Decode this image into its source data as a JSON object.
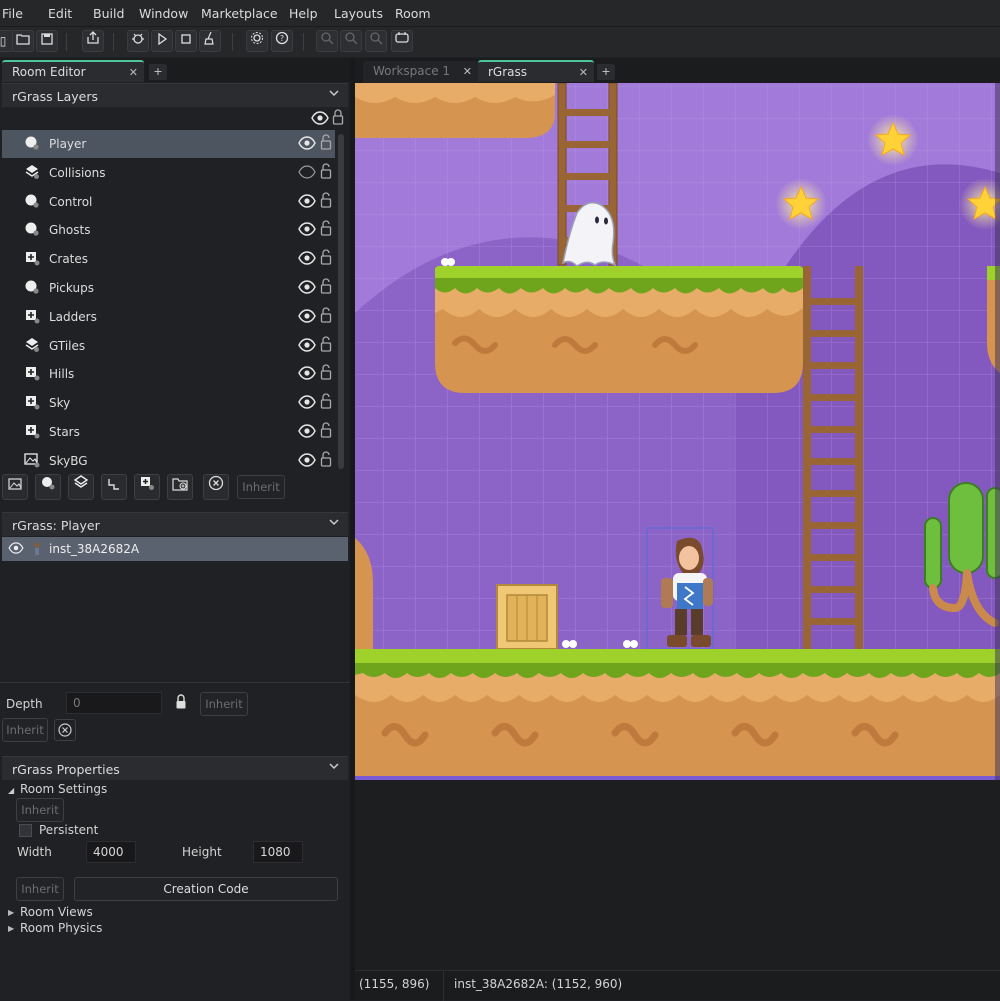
{
  "menu": [
    "File",
    "Edit",
    "Build",
    "Window",
    "Marketplace",
    "Help",
    "Layouts",
    "Room"
  ],
  "left_tabs": {
    "room_editor": "Room Editor",
    "add": "+"
  },
  "layers_panel": {
    "title": "rGrass Layers",
    "layers": [
      {
        "name": "Player",
        "type": "instance",
        "visible": true,
        "selected": true
      },
      {
        "name": "Collisions",
        "type": "tile",
        "visible": false
      },
      {
        "name": "Control",
        "type": "instance",
        "visible": true
      },
      {
        "name": "Ghosts",
        "type": "instance",
        "visible": true
      },
      {
        "name": "Crates",
        "type": "asset",
        "visible": true
      },
      {
        "name": "Pickups",
        "type": "instance",
        "visible": true
      },
      {
        "name": "Ladders",
        "type": "asset",
        "visible": true
      },
      {
        "name": "GTiles",
        "type": "tile",
        "visible": true
      },
      {
        "name": "Hills",
        "type": "asset",
        "visible": true
      },
      {
        "name": "Sky",
        "type": "asset",
        "visible": true
      },
      {
        "name": "Stars",
        "type": "asset",
        "visible": true
      },
      {
        "name": "SkyBG",
        "type": "background",
        "visible": true
      }
    ],
    "inherit_label": "Inherit"
  },
  "instances_panel": {
    "title": "rGrass: Player",
    "instances": [
      "inst_38A2682A"
    ]
  },
  "depth": {
    "label": "Depth",
    "value": "0",
    "inherit_label": "Inherit",
    "inherit2_label": "Inherit"
  },
  "properties": {
    "title": "rGrass Properties",
    "room_settings": "Room Settings",
    "inherit_label": "Inherit",
    "persistent_label": "Persistent",
    "width_label": "Width",
    "width_value": "4000",
    "height_label": "Height",
    "height_value": "1080",
    "inherit2_label": "Inherit",
    "creation_code": "Creation Code",
    "room_views": "Room Views",
    "room_physics": "Room Physics"
  },
  "right_tabs": {
    "workspace": "Workspace 1",
    "room": "rGrass",
    "add": "+"
  },
  "status": {
    "cursor": "(1155, 896)",
    "instance": "inst_38A2682A: (1152, 960)"
  },
  "colors": {
    "accent": "#4fc39a",
    "sky": "#a07ad8",
    "grass": "#9ed22a",
    "dirt": "#d89a55",
    "selection": "#4d5561"
  }
}
